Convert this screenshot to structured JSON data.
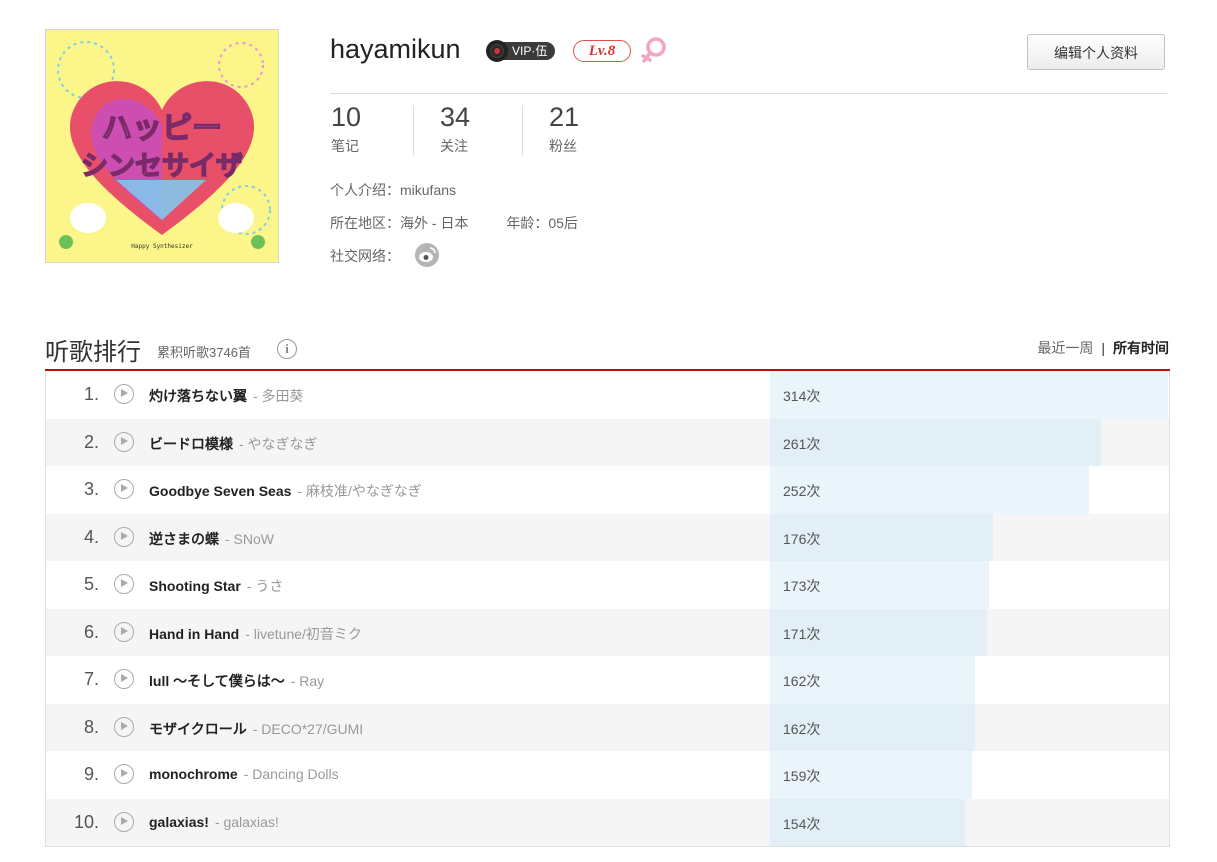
{
  "profile": {
    "avatar_text_line1": "ハッピー",
    "avatar_text_line2": "シンセサイザ",
    "avatar_caption": "Happy Synthesizer",
    "username": "hayamikun",
    "vip_label": "VIP·伍",
    "level_label": "Lv.8",
    "gender_icon": "female-icon",
    "edit_button": "编辑个人资料",
    "stats": [
      {
        "num": "10",
        "label": "笔记"
      },
      {
        "num": "34",
        "label": "关注"
      },
      {
        "num": "21",
        "label": "粉丝"
      }
    ],
    "intro_label": "个人介绍：",
    "intro_value": "mikufans",
    "region_label": "所在地区：",
    "region_value": "海外 - 日本",
    "age_label": "年龄：",
    "age_value": "05后",
    "social_label": "社交网络：",
    "social_icon": "weibo-icon"
  },
  "ranking": {
    "title": "听歌排行",
    "subtitle": "累积听歌3746首",
    "period_week": "最近一周",
    "period_sep": "|",
    "period_all": "所有时间",
    "max_count": 314,
    "rows": [
      {
        "idx": "1.",
        "title": "灼け落ちない翼",
        "artist": "- 多田葵",
        "count": "314次",
        "value": 314
      },
      {
        "idx": "2.",
        "title": "ビードロ模様",
        "artist": "- やなぎなぎ",
        "count": "261次",
        "value": 261
      },
      {
        "idx": "3.",
        "title": "Goodbye Seven Seas",
        "artist": "- 麻枝准/やなぎなぎ",
        "count": "252次",
        "value": 252
      },
      {
        "idx": "4.",
        "title": "逆さまの蝶",
        "artist": "- SNoW",
        "count": "176次",
        "value": 176
      },
      {
        "idx": "5.",
        "title": "Shooting Star",
        "artist": "- うさ",
        "count": "173次",
        "value": 173
      },
      {
        "idx": "6.",
        "title": "Hand in Hand",
        "artist": "- livetune/初音ミク",
        "count": "171次",
        "value": 171
      },
      {
        "idx": "7.",
        "title": "lull ～そして僕らは～",
        "artist": "- Ray",
        "count": "162次",
        "value": 162
      },
      {
        "idx": "8.",
        "title": "モザイクロール",
        "artist": "- DECO*27/GUMI",
        "count": "162次",
        "value": 162
      },
      {
        "idx": "9.",
        "title": "monochrome",
        "artist": "- Dancing Dolls",
        "count": "159次",
        "value": 159
      },
      {
        "idx": "10.",
        "title": "galaxias!",
        "artist": "- galaxias!",
        "count": "154次",
        "value": 154
      }
    ]
  },
  "colors": {
    "accent_red": "#c20c0c",
    "bar_fill": "#eaf4fb"
  }
}
